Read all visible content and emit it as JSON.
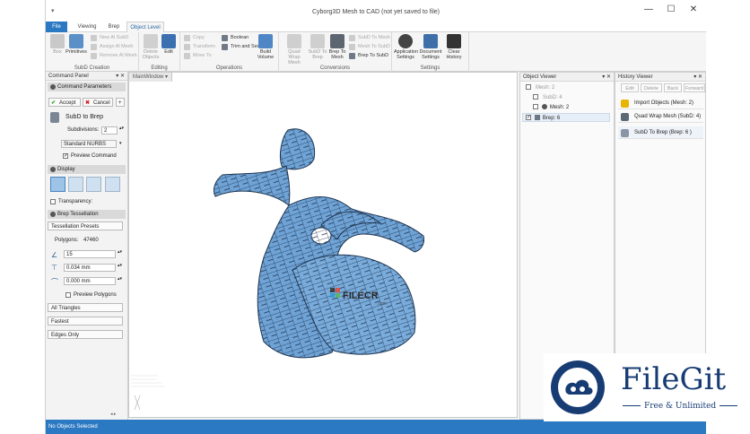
{
  "window": {
    "title": "Cyborg3D Mesh to CAD  (not yet saved to file)",
    "quick_access": "▾",
    "controls": [
      "—",
      "☐",
      "✕"
    ]
  },
  "tabs": [
    {
      "label": "File"
    },
    {
      "label": "Viewing"
    },
    {
      "label": "Brep"
    },
    {
      "label": "Object Level"
    }
  ],
  "ribbon": {
    "subd_creation": {
      "label": "SubD Creation",
      "box": "Box",
      "primitives": "Primitives",
      "new_subd": "New Al SubD",
      "assign_mesh": "Assign Al Mesh",
      "remove_mesh": "Remove Al Mesh"
    },
    "editing": {
      "label": "Editing",
      "delete": "Delete Objects",
      "edit": "Edit"
    },
    "operations": {
      "label": "Operations",
      "copy": "Copy",
      "transform": "Transform",
      "move_to": "Move To",
      "boolean": "Boolean",
      "trim_sew": "Trim and Sew",
      "build_volume": "Build Volume"
    },
    "conversions": {
      "label": "Conversions",
      "quad_wrap": "Quad Wrap Mesh",
      "subd_to_brep": "SubD To Brep",
      "brep_to_mesh": "Brep To Mesh",
      "subd_to_mesh": "SubD To Mesh",
      "mesh_to_subd": "Mesh To SubD",
      "brep_to_subd": "Brep To SubD"
    },
    "settings": {
      "label": "Settings",
      "app": "Application Settings",
      "doc": "Document Settings",
      "clear": "Clear History"
    }
  },
  "command_panel": {
    "title": "Command Panel",
    "pin": "▾ ✕",
    "params_header": "Command Parameters",
    "accept": "Accept",
    "cancel": "Cancel",
    "plus": "+",
    "command_name": "SubD to Brep",
    "subdivisions_label": "Subdivisions:",
    "subdivisions_value": "2",
    "nurbs_option": "Standard NURBS",
    "preview_command": "Preview Command",
    "display_header": "Display",
    "transparency": "Transparency:",
    "tess_header": "Brep Tessellation",
    "tess_presets": "Tessellation Presets",
    "polygons_label": "Polygons:",
    "polygons_value": "47460",
    "angle_value": "15",
    "dist1_value": "0.034 mm",
    "dist2_value": "0.000 mm",
    "preview_polygons": "Preview Polygons",
    "presets": [
      "All Triangles",
      "Fastest",
      "Edges Only"
    ],
    "nav": "◂ ▸"
  },
  "viewport": {
    "tab_label": "MainWindow",
    "tab_pin": "▾",
    "watermark_main": "FILECR",
    "watermark_sub": ".com"
  },
  "object_viewer": {
    "title": "Object Viewer",
    "pin": "▾ ✕",
    "items": [
      {
        "label": "Mesh: 2",
        "checked": false
      },
      {
        "label": "SubD: 4",
        "checked": false
      },
      {
        "label": "Mesh: 2",
        "checked": false
      },
      {
        "label": "Brep: 6",
        "checked": true
      }
    ]
  },
  "history_viewer": {
    "title": "History Viewer",
    "pin": "▾ ✕",
    "buttons": [
      "Edit",
      "Delete",
      "Back",
      "Forward"
    ],
    "items": [
      {
        "label": "Import Objects (Mesh: 2)",
        "color": "#e8b400"
      },
      {
        "label": "Quad Wrap Mesh (SubD: 4)",
        "color": "#5c6a78"
      },
      {
        "label": "SubD To Brep (Brep: 6 )",
        "color": "#8896a6"
      }
    ]
  },
  "status": {
    "text": "No Objects Selected"
  },
  "logo": {
    "name": "FileGit",
    "tagline": "Free & Unlimited"
  },
  "colors": {
    "accent": "#2b79c2",
    "model": "#6fa3d6"
  }
}
